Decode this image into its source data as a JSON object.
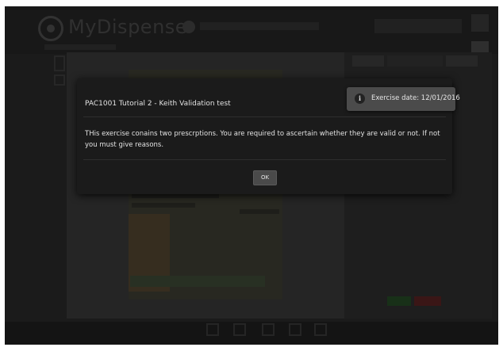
{
  "app": {
    "title": "MyDispense"
  },
  "modal": {
    "title": "PAC1001 Tutorial 2 - Keith Validation test",
    "body": "THis exercise conains two prescrptions. You are required to ascertain whether they are valid or not. If not you must give reasons.",
    "ok_label": "OK"
  },
  "exercise": {
    "date_label": "Exercise date: 12/01/2016",
    "info_icon": "info-icon"
  }
}
